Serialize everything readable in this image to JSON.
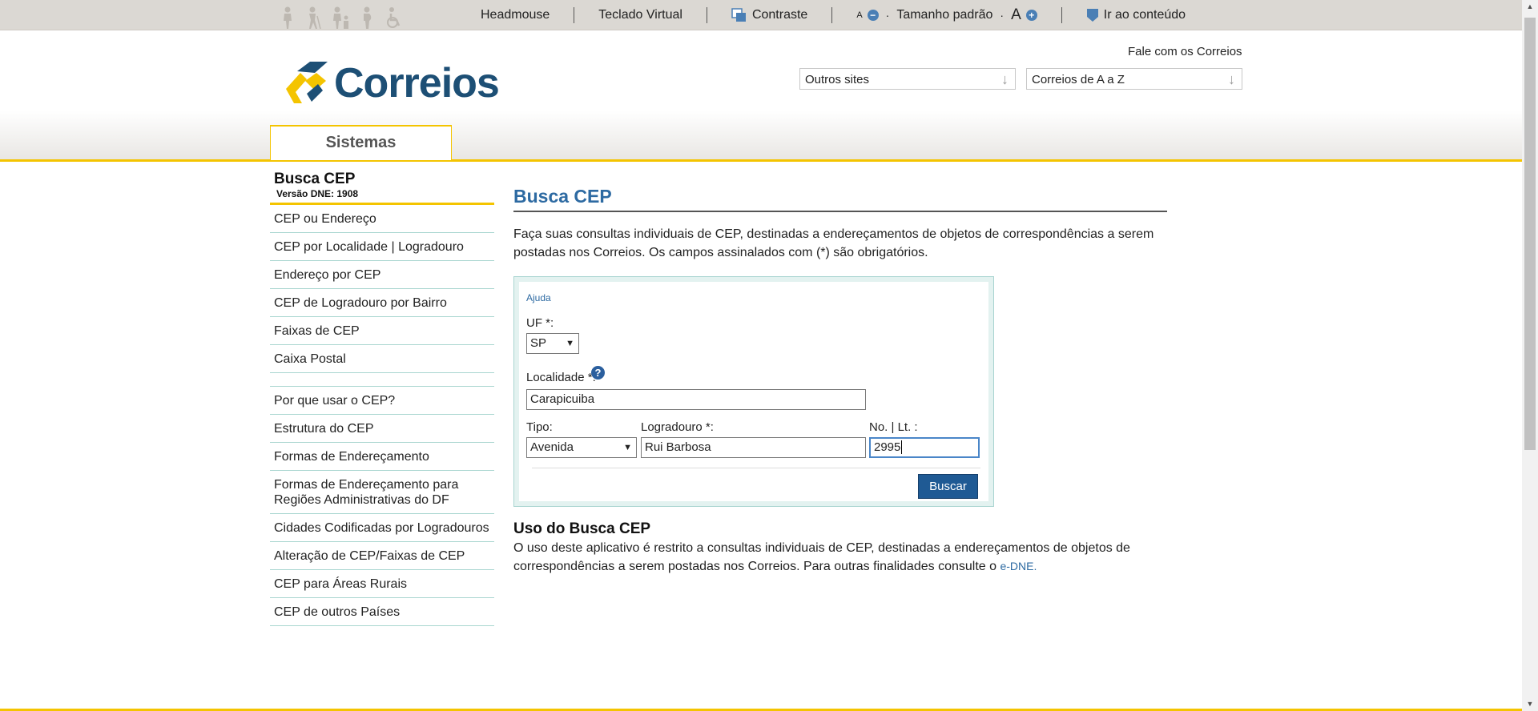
{
  "a11y_bar": {
    "icons": [
      "person-elderly-icon",
      "person-cane-icon",
      "person-with-child-icon",
      "pregnant-person-icon",
      "wheelchair-icon"
    ],
    "headmouse": "Headmouse",
    "teclado": "Teclado Virtual",
    "contraste": "Contraste",
    "font_small": "A",
    "tamanho": "Tamanho padrão",
    "font_large": "A",
    "ir_conteudo": "Ir ao conteúdo",
    "separator_dot": "·"
  },
  "header": {
    "logo_text": "Correios",
    "fale": "Fale com os Correios",
    "outros_sites": "Outros sites",
    "correios_az": "Correios de A a Z",
    "tab": "Sistemas"
  },
  "sidebar": {
    "title": "Busca CEP",
    "version": "Versão DNE: 1908",
    "items": [
      "CEP ou Endereço",
      "CEP por Localidade | Logradouro",
      "Endereço por CEP",
      "CEP de Logradouro por Bairro",
      "Faixas de CEP",
      "Caixa Postal"
    ],
    "items2": [
      "Por que usar o CEP?",
      "Estrutura do CEP",
      "Formas de Endereçamento",
      "Formas de Endereçamento para Regiões Administrativas do DF",
      "Cidades Codificadas por Logradouros",
      "Alteração de CEP/Faixas de CEP",
      "CEP para Áreas Rurais",
      "CEP de outros Países"
    ]
  },
  "main": {
    "title": "Busca CEP",
    "intro": "Faça suas consultas individuais de CEP, destinadas a endereçamentos de objetos de correspondências a serem postadas nos Correios. Os campos assinalados com (*) são obrigatórios.",
    "form": {
      "ajuda": "Ajuda",
      "uf_label": "UF *:",
      "uf_value": "SP",
      "localidade_label": "Localidade *:",
      "localidade_value": "Carapicuiba",
      "tipo_label": "Tipo:",
      "tipo_value": "Avenida",
      "logradouro_label": "Logradouro *:",
      "logradouro_value": "Rui Barbosa",
      "numero_label": "No. | Lt. :",
      "numero_value": "2995",
      "buscar": "Buscar"
    },
    "uso_title": "Uso do Busca CEP",
    "uso_text": "O uso deste aplicativo é restrito a consultas individuais de CEP, destinadas a endereçamentos de objetos de correspondências a serem postadas nos Correios. Para outras finalidades consulte o ",
    "uso_link": "e-DNE."
  },
  "colors": {
    "brand_blue": "#1d4f75",
    "brand_yellow": "#f4c400",
    "link_blue": "#2d6aa2"
  }
}
